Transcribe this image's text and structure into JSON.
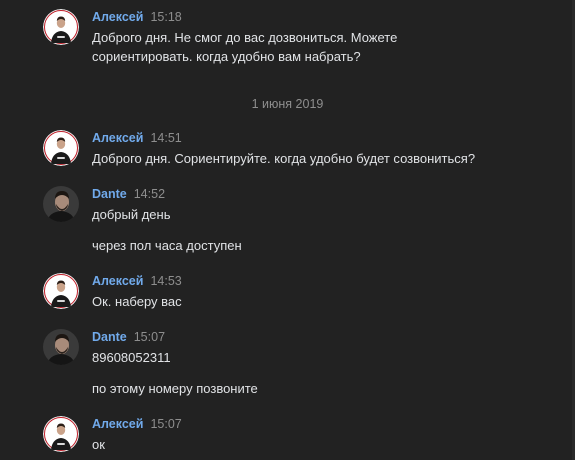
{
  "date_separator": "1 июня 2019",
  "groups": [
    {
      "author": "Алексей",
      "time": "15:18",
      "lines": [
        "Доброго дня. Не смог до вас дозвониться. Можете",
        "сориентировать. когда удобно вам набрать?"
      ]
    },
    {
      "author": "Алексей",
      "time": "14:51",
      "lines": [
        "Доброго дня. Сориентируйте. когда удобно будет созвониться?"
      ]
    },
    {
      "author": "Dante",
      "time": "14:52",
      "lines": [
        "добрый день",
        "через пол часа доступен"
      ]
    },
    {
      "author": "Алексей",
      "time": "14:53",
      "lines": [
        "Ок. наберу вас"
      ]
    },
    {
      "author": "Dante",
      "time": "15:07",
      "lines": [
        "89608052311",
        "по этому номеру позвоните"
      ]
    },
    {
      "author": "Алексей",
      "time": "15:07",
      "lines": [
        "ок"
      ]
    }
  ],
  "colors": {
    "background": "#222222",
    "author_name": "#71aaeb",
    "message_text": "#e1e3e6",
    "timestamp": "#8e8e8e"
  }
}
